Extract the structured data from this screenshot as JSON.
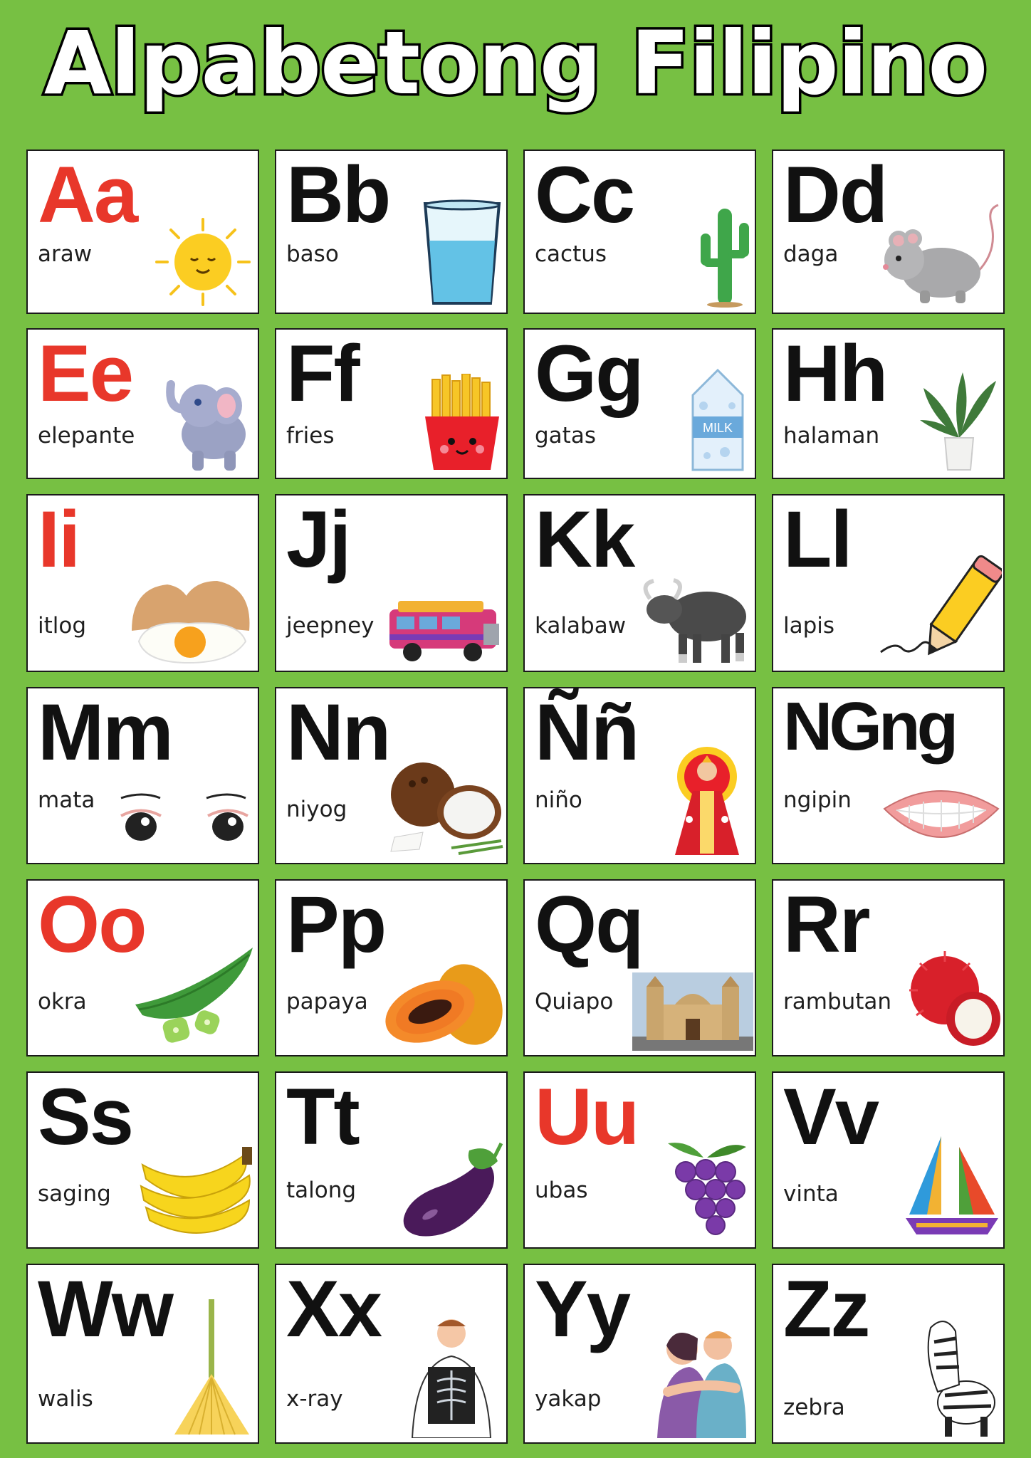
{
  "title": "Alpabetong Filipino",
  "colors": {
    "background": "#77c043",
    "vowel_letter": "#e8372a",
    "consonant_letter": "#111111"
  },
  "cards": [
    {
      "letter": "Aa",
      "word": "araw",
      "vowel": true,
      "icon": "sun-icon"
    },
    {
      "letter": "Bb",
      "word": "baso",
      "vowel": false,
      "icon": "glass-icon"
    },
    {
      "letter": "Cc",
      "word": "cactus",
      "vowel": false,
      "icon": "cactus-icon"
    },
    {
      "letter": "Dd",
      "word": "daga",
      "vowel": false,
      "icon": "mouse-icon"
    },
    {
      "letter": "Ee",
      "word": "elepante",
      "vowel": true,
      "icon": "elephant-icon"
    },
    {
      "letter": "Ff",
      "word": "fries",
      "vowel": false,
      "icon": "fries-icon"
    },
    {
      "letter": "Gg",
      "word": "gatas",
      "vowel": false,
      "icon": "milk-carton-icon"
    },
    {
      "letter": "Hh",
      "word": "halaman",
      "vowel": false,
      "icon": "plant-icon"
    },
    {
      "letter": "Ii",
      "word": "itlog",
      "vowel": true,
      "icon": "egg-icon"
    },
    {
      "letter": "Jj",
      "word": "jeepney",
      "vowel": false,
      "icon": "jeepney-icon"
    },
    {
      "letter": "Kk",
      "word": "kalabaw",
      "vowel": false,
      "icon": "carabao-icon"
    },
    {
      "letter": "Ll",
      "word": "lapis",
      "vowel": false,
      "icon": "pencil-icon"
    },
    {
      "letter": "Mm",
      "word": "mata",
      "vowel": false,
      "icon": "eyes-icon"
    },
    {
      "letter": "Nn",
      "word": "niyog",
      "vowel": false,
      "icon": "coconut-icon"
    },
    {
      "letter": "Ññ",
      "word": "niño",
      "vowel": false,
      "icon": "santo-nino-icon"
    },
    {
      "letter": "NGng",
      "word": "ngipin",
      "vowel": false,
      "icon": "teeth-icon"
    },
    {
      "letter": "Oo",
      "word": "okra",
      "vowel": true,
      "icon": "okra-icon"
    },
    {
      "letter": "Pp",
      "word": "papaya",
      "vowel": false,
      "icon": "papaya-icon"
    },
    {
      "letter": "Qq",
      "word": "Quiapo",
      "vowel": false,
      "icon": "church-icon"
    },
    {
      "letter": "Rr",
      "word": "rambutan",
      "vowel": false,
      "icon": "rambutan-icon"
    },
    {
      "letter": "Ss",
      "word": "saging",
      "vowel": false,
      "icon": "banana-icon"
    },
    {
      "letter": "Tt",
      "word": "talong",
      "vowel": false,
      "icon": "eggplant-icon"
    },
    {
      "letter": "Uu",
      "word": "ubas",
      "vowel": true,
      "icon": "grapes-icon"
    },
    {
      "letter": "Vv",
      "word": "vinta",
      "vowel": false,
      "icon": "vinta-boat-icon"
    },
    {
      "letter": "Ww",
      "word": "walis",
      "vowel": false,
      "icon": "broom-icon"
    },
    {
      "letter": "Xx",
      "word": "x-ray",
      "vowel": false,
      "icon": "xray-icon"
    },
    {
      "letter": "Yy",
      "word": "yakap",
      "vowel": false,
      "icon": "hug-icon"
    },
    {
      "letter": "Zz",
      "word": "zebra",
      "vowel": false,
      "icon": "zebra-icon"
    }
  ]
}
